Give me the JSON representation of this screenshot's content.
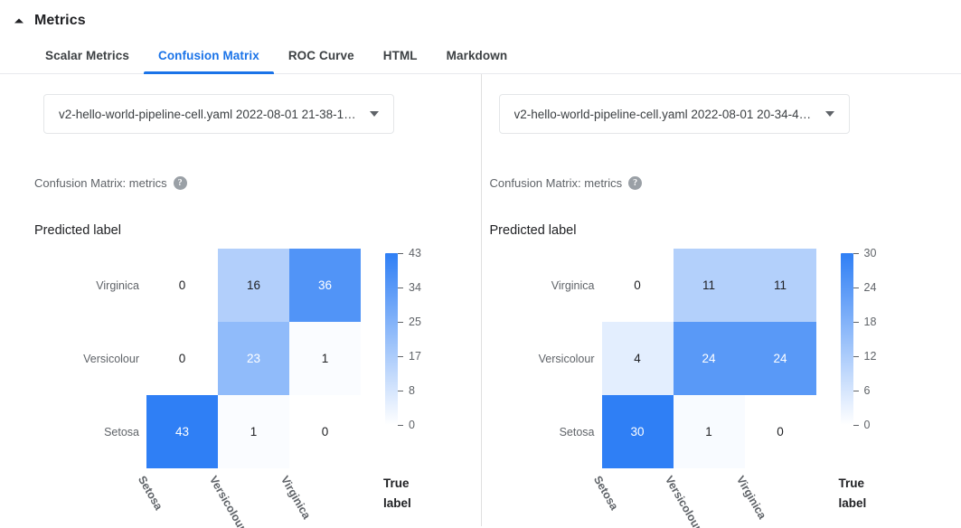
{
  "header": {
    "title": "Metrics",
    "collapse_icon": "caret-up-icon"
  },
  "tabs": [
    {
      "label": "Scalar Metrics",
      "active": false
    },
    {
      "label": "Confusion Matrix",
      "active": true
    },
    {
      "label": "ROC Curve",
      "active": false
    },
    {
      "label": "HTML",
      "active": false
    },
    {
      "label": "Markdown",
      "active": false
    }
  ],
  "accent_color": "#1a73e8",
  "panels": [
    {
      "select_value": "v2-hello-world-pipeline-cell.yaml 2022-08-01 21-38-1…",
      "select_icon": "chevron-down-icon",
      "caption": "Confusion Matrix: metrics",
      "help_icon": "help-circle-icon",
      "axis_title_x": "Predicted label",
      "axis_title_y": "True label"
    },
    {
      "select_value": "v2-hello-world-pipeline-cell.yaml 2022-08-01 20-34-4…",
      "select_icon": "chevron-down-icon",
      "caption": "Confusion Matrix: metrics",
      "help_icon": "help-circle-icon",
      "axis_title_x": "Predicted label",
      "axis_title_y": "True label"
    }
  ],
  "chart_data": [
    {
      "type": "heatmap",
      "title": "Confusion Matrix: metrics",
      "xlabel": "Predicted label",
      "ylabel": "True label",
      "x_categories": [
        "Setosa",
        "Versicolour",
        "Virginica"
      ],
      "y_categories": [
        "Virginica",
        "Versicolour",
        "Setosa"
      ],
      "values": [
        [
          0,
          16,
          36
        ],
        [
          0,
          23,
          1
        ],
        [
          43,
          1,
          0
        ]
      ],
      "colorbar": {
        "ticks": [
          43,
          34,
          25,
          17,
          8,
          0
        ],
        "min": 0,
        "max": 43,
        "colormap": [
          "#ffffff",
          "#2f7ff5"
        ]
      }
    },
    {
      "type": "heatmap",
      "title": "Confusion Matrix: metrics",
      "xlabel": "Predicted label",
      "ylabel": "True label",
      "x_categories": [
        "Setosa",
        "Versicolour",
        "Virginica"
      ],
      "y_categories": [
        "Virginica",
        "Versicolour",
        "Setosa"
      ],
      "values": [
        [
          0,
          11,
          11
        ],
        [
          4,
          24,
          24
        ],
        [
          30,
          1,
          0
        ]
      ],
      "colorbar": {
        "ticks": [
          30,
          24,
          18,
          12,
          6,
          0
        ],
        "min": 0,
        "max": 30,
        "colormap": [
          "#ffffff",
          "#2f7ff5"
        ]
      }
    }
  ]
}
